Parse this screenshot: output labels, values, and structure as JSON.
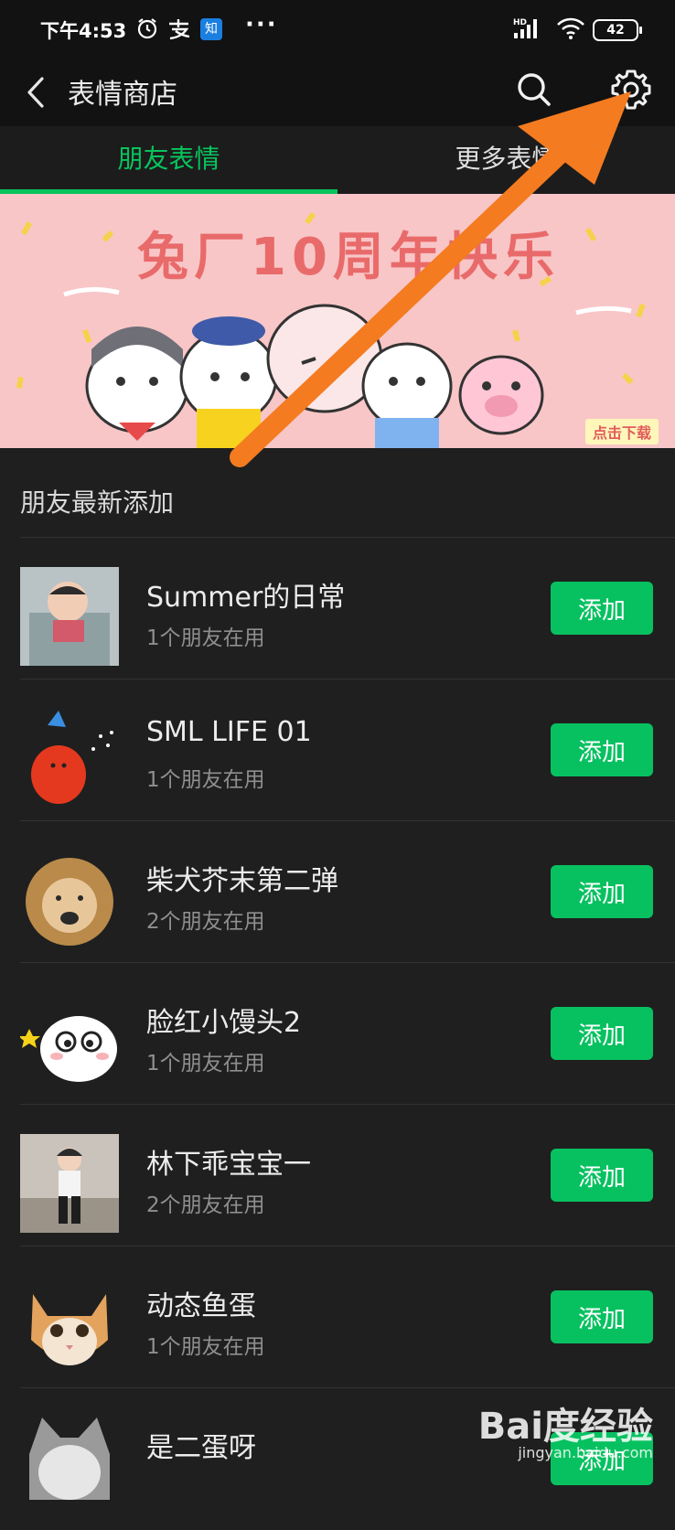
{
  "status_bar": {
    "time": "下午4:53",
    "network": "HD",
    "battery": "42"
  },
  "header": {
    "title": "表情商店"
  },
  "tabs": [
    {
      "label": "朋友表情",
      "active": true
    },
    {
      "label": "更多表情",
      "active": false
    }
  ],
  "banner": {
    "text": "兔厂10周年快乐",
    "button": "点击下载"
  },
  "section": {
    "title": "朋友最新添加"
  },
  "items": [
    {
      "name": "Summer的日常",
      "usage": "1个朋友在用",
      "button": "添加"
    },
    {
      "name": "SML LIFE 01",
      "usage": "1个朋友在用",
      "button": "添加"
    },
    {
      "name": "柴犬芥末第二弹",
      "usage": "2个朋友在用",
      "button": "添加"
    },
    {
      "name": "脸红小馒头2",
      "usage": "1个朋友在用",
      "button": "添加"
    },
    {
      "name": "林下乖宝宝一",
      "usage": "2个朋友在用",
      "button": "添加"
    },
    {
      "name": "动态鱼蛋",
      "usage": "1个朋友在用",
      "button": "添加"
    },
    {
      "name": "是二蛋呀",
      "usage": "",
      "button": "添加"
    }
  ],
  "watermark": {
    "brand": "Bai度经验",
    "url": "jingyan.baidu.com"
  },
  "colors": {
    "accent": "#07c160",
    "background": "#1f1f1f",
    "annotation_arrow": "#f47b20"
  }
}
